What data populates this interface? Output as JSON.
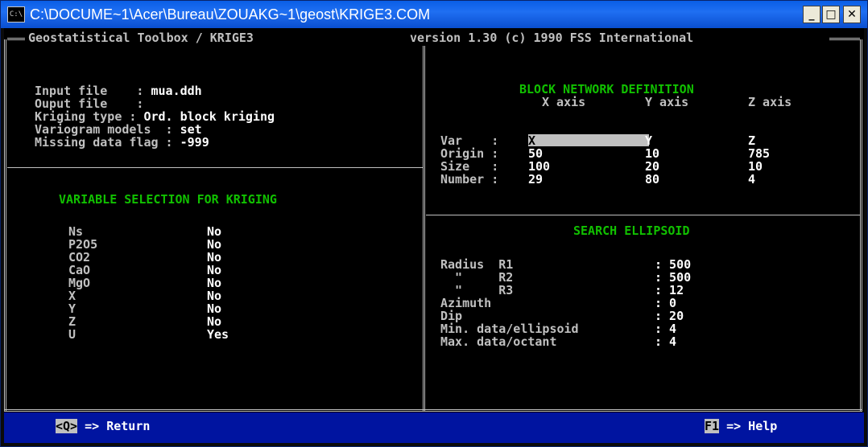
{
  "window": {
    "title": "C:\\DOCUME~1\\Acer\\Bureau\\ZOUAKG~1\\geost\\KRIGE3.COM",
    "icon_text": "C:\\",
    "min_icon": "minimize-icon",
    "max_icon": "maximize-icon",
    "close_icon": "close-icon"
  },
  "header": {
    "left": "Geostatistical Toolbox / KRIGE3",
    "right": "version 1.30 (c) 1990 FSS International"
  },
  "info": {
    "input_label": "Input file    : ",
    "input_value": "mua.ddh",
    "output_label": "Ouput file    :",
    "kriging_label": "Kriging type : ",
    "kriging_value": "Ord. block kriging",
    "variogram_label": "Variogram models  : ",
    "variogram_value": "set",
    "missing_label": "Missing data flag : ",
    "missing_value": "-999"
  },
  "variable_selection": {
    "title": "VARIABLE SELECTION FOR KRIGING",
    "items": [
      {
        "name": "Ns",
        "value": "No"
      },
      {
        "name": "P2O5",
        "value": "No"
      },
      {
        "name": "CO2",
        "value": "No"
      },
      {
        "name": "CaO",
        "value": "No"
      },
      {
        "name": "MgO",
        "value": "No"
      },
      {
        "name": "X",
        "value": "No"
      },
      {
        "name": "Y",
        "value": "No"
      },
      {
        "name": "Z",
        "value": "No"
      },
      {
        "name": "U",
        "value": "Yes"
      }
    ]
  },
  "block_network": {
    "title": "BLOCK NETWORK DEFINITION",
    "col_x": "X axis",
    "col_y": "Y axis",
    "col_z": "Z axis",
    "rows": [
      {
        "label": "Var    : ",
        "x": "X",
        "y": "Y",
        "z": "Z"
      },
      {
        "label": "Origin : ",
        "x": "50",
        "y": "10",
        "z": "785"
      },
      {
        "label": "Size   : ",
        "x": "100",
        "y": "20",
        "z": "10"
      },
      {
        "label": "Number : ",
        "x": "29",
        "y": "80",
        "z": "4"
      }
    ]
  },
  "search_ellipsoid": {
    "title": "SEARCH ELLIPSOID",
    "rows": [
      {
        "label": "Radius  R1",
        "value": ": 500"
      },
      {
        "label": "  \"     R2",
        "value": ": 500"
      },
      {
        "label": "  \"     R3",
        "value": ": 12"
      },
      {
        "label": "Azimuth",
        "value": ": 0"
      },
      {
        "label": "Dip",
        "value": ": 20"
      },
      {
        "label": "Min. data/ellipsoid",
        "value": ": 4"
      },
      {
        "label": "Max. data/octant",
        "value": ": 4"
      }
    ]
  },
  "status": {
    "return_key": "<Q>",
    "return_text": " => Return",
    "help_key": "F1",
    "help_text": " => Help"
  }
}
